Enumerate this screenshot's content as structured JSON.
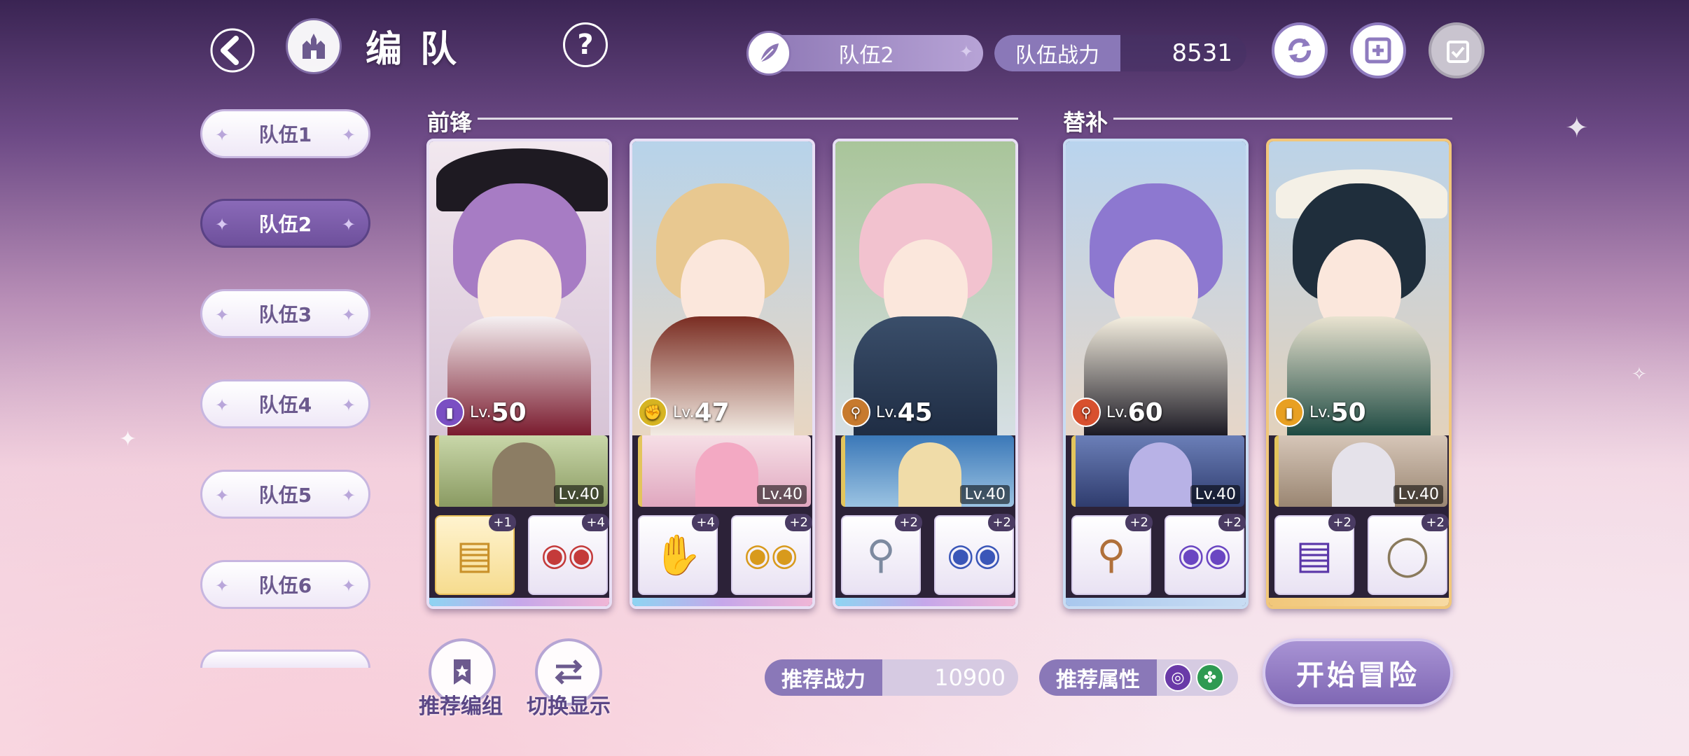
{
  "header": {
    "title": "编队",
    "selected_team": "队伍2",
    "power_label": "队伍战力",
    "power_value": "8531"
  },
  "sidebar": {
    "tabs": [
      {
        "label": "队伍1",
        "active": false
      },
      {
        "label": "队伍2",
        "active": true
      },
      {
        "label": "队伍3",
        "active": false
      },
      {
        "label": "队伍4",
        "active": false
      },
      {
        "label": "队伍5",
        "active": false
      },
      {
        "label": "队伍6",
        "active": false
      }
    ]
  },
  "sections": {
    "front": "前锋",
    "sub": "替补"
  },
  "cards": [
    {
      "element": "book-icon",
      "element_color": "#7a4fc3",
      "lv_prefix": "Lv.",
      "level": "50",
      "support_lv": "Lv.40",
      "equip": [
        {
          "icon": "tome-icon",
          "plus": "+1",
          "gold": true
        },
        {
          "icon": "earrings-icon",
          "plus": "+4",
          "gold": false
        }
      ]
    },
    {
      "element": "fist-icon",
      "element_color": "#d6b422",
      "lv_prefix": "Lv.",
      "level": "47",
      "support_lv": "Lv.40",
      "equip": [
        {
          "icon": "gauntlet-icon",
          "plus": "+4",
          "gold": false
        },
        {
          "icon": "earrings-icon",
          "plus": "+2",
          "gold": false
        }
      ]
    },
    {
      "element": "wand-icon",
      "element_color": "#c77a2e",
      "lv_prefix": "Lv.",
      "level": "45",
      "support_lv": "Lv.40",
      "equip": [
        {
          "icon": "wand-icon",
          "plus": "+2",
          "gold": false
        },
        {
          "icon": "earrings-icon",
          "plus": "+2",
          "gold": false
        }
      ]
    },
    {
      "element": "wand-icon",
      "element_color": "#d8502e",
      "lv_prefix": "Lv.",
      "level": "60",
      "support_lv": "Lv.40",
      "equip": [
        {
          "icon": "scepter-icon",
          "plus": "+2",
          "gold": false
        },
        {
          "icon": "earrings-icon",
          "plus": "+2",
          "gold": false
        }
      ]
    },
    {
      "element": "book-icon",
      "element_color": "#e8a022",
      "lv_prefix": "Lv.",
      "level": "50",
      "support_lv": "Lv.40",
      "equip": [
        {
          "icon": "tome-icon",
          "plus": "+2",
          "gold": false
        },
        {
          "icon": "ring-icon",
          "plus": "+2",
          "gold": false
        }
      ]
    }
  ],
  "bottom": {
    "recommend_team": "推荐编组",
    "toggle_display": "切换显示",
    "rec_power_label": "推荐战力",
    "rec_power_value": "10900",
    "rec_attr_label": "推荐属性",
    "start_label": "开始冒险"
  },
  "colors": {
    "accent": "#8a78b8",
    "active_tab": "#6e509c"
  }
}
